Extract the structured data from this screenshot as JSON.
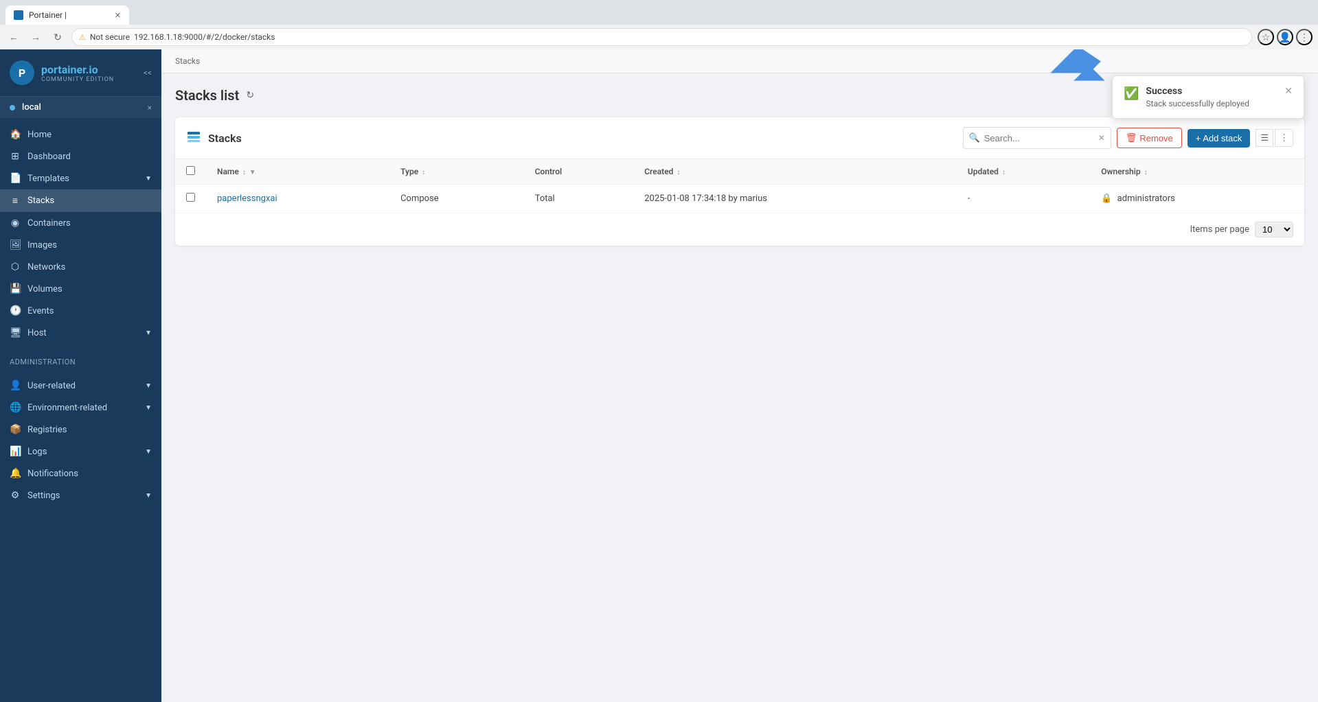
{
  "browser": {
    "tab_title": "Portainer |",
    "url": "192.168.1.18:9000/#/2/docker/stacks",
    "security_label": "Not secure"
  },
  "sidebar": {
    "brand": "portainer.io",
    "edition": "COMMUNITY EDITION",
    "collapse_label": "<<",
    "environment": {
      "name": "local",
      "close": "×"
    },
    "nav_items": [
      {
        "id": "home",
        "label": "Home",
        "icon": "🏠",
        "active": false
      },
      {
        "id": "dashboard",
        "label": "Dashboard",
        "icon": "⊞",
        "active": false
      },
      {
        "id": "templates",
        "label": "Templates",
        "icon": "📄",
        "active": false,
        "has_chevron": true
      },
      {
        "id": "stacks",
        "label": "Stacks",
        "icon": "≡",
        "active": true
      },
      {
        "id": "containers",
        "label": "Containers",
        "icon": "◉",
        "active": false
      },
      {
        "id": "images",
        "label": "Images",
        "icon": "🖼",
        "active": false
      },
      {
        "id": "networks",
        "label": "Networks",
        "icon": "⬡",
        "active": false
      },
      {
        "id": "volumes",
        "label": "Volumes",
        "icon": "💾",
        "active": false
      },
      {
        "id": "events",
        "label": "Events",
        "icon": "🕐",
        "active": false
      },
      {
        "id": "host",
        "label": "Host",
        "icon": "🖥",
        "active": false,
        "has_chevron": true
      }
    ],
    "admin_label": "Administration",
    "admin_items": [
      {
        "id": "user-related",
        "label": "User-related",
        "icon": "👤",
        "has_chevron": true
      },
      {
        "id": "environment-related",
        "label": "Environment-related",
        "icon": "🌐",
        "has_chevron": true
      },
      {
        "id": "registries",
        "label": "Registries",
        "icon": "📦",
        "has_chevron": false
      },
      {
        "id": "logs",
        "label": "Logs",
        "icon": "📊",
        "has_chevron": true
      },
      {
        "id": "notifications",
        "label": "Notifications",
        "icon": "🔔",
        "has_chevron": false
      },
      {
        "id": "settings",
        "label": "Settings",
        "icon": "⚙",
        "has_chevron": true
      }
    ]
  },
  "breadcrumb": "Stacks",
  "page": {
    "title": "Stacks list"
  },
  "panel": {
    "title": "Stacks",
    "search_placeholder": "Search...",
    "remove_label": "Remove",
    "add_label": "+ Add stack"
  },
  "table": {
    "columns": [
      "Name",
      "Type",
      "Control",
      "Created",
      "Updated",
      "Ownership"
    ],
    "rows": [
      {
        "name": "paperlessngxai",
        "type": "Compose",
        "control": "Total",
        "created": "2025-01-08 17:34:18 by marius",
        "updated": "-",
        "ownership": "administrators"
      }
    ]
  },
  "pagination": {
    "label": "Items per page",
    "value": "10"
  },
  "notification": {
    "title": "Success",
    "message": "Stack successfully deployed"
  }
}
